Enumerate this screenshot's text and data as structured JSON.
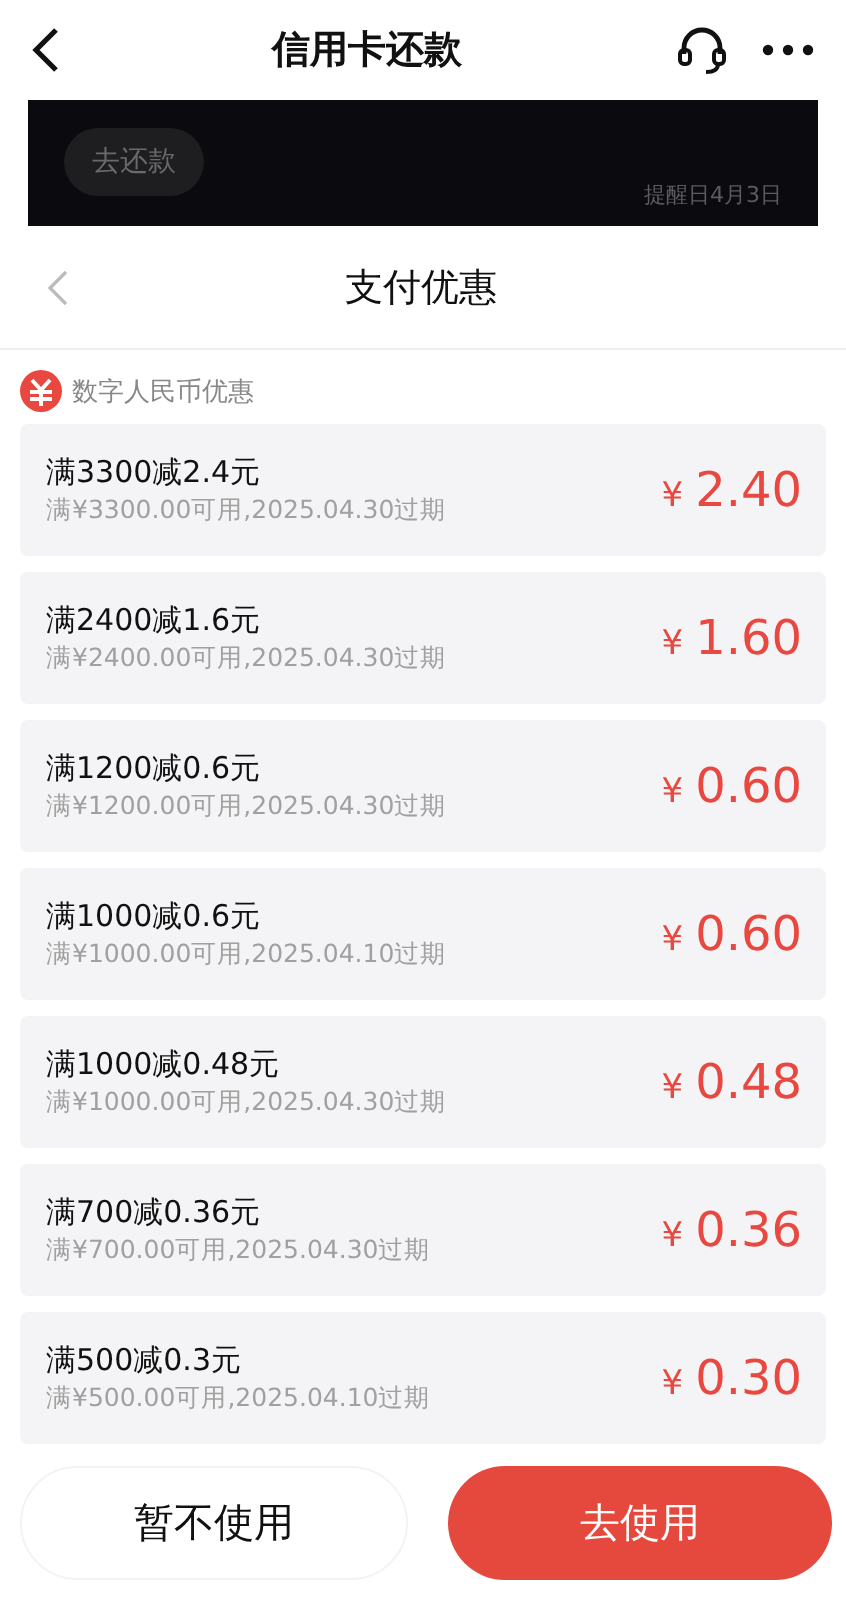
{
  "header": {
    "title": "信用卡还款"
  },
  "background": {
    "button": "去还款",
    "reminder": "提醒日4月3日"
  },
  "sheet": {
    "title": "支付优惠",
    "section": "数字人民币优惠",
    "coupons": [
      {
        "title": "满3300减2.4元",
        "detail": "满¥3300.00可用,2025.04.30过期",
        "currency": "¥",
        "amount": "2.40"
      },
      {
        "title": "满2400减1.6元",
        "detail": "满¥2400.00可用,2025.04.30过期",
        "currency": "¥",
        "amount": "1.60"
      },
      {
        "title": "满1200减0.6元",
        "detail": "满¥1200.00可用,2025.04.30过期",
        "currency": "¥",
        "amount": "0.60"
      },
      {
        "title": "满1000减0.6元",
        "detail": "满¥1000.00可用,2025.04.10过期",
        "currency": "¥",
        "amount": "0.60"
      },
      {
        "title": "满1000减0.48元",
        "detail": "满¥1000.00可用,2025.04.30过期",
        "currency": "¥",
        "amount": "0.48"
      },
      {
        "title": "满700减0.36元",
        "detail": "满¥700.00可用,2025.04.30过期",
        "currency": "¥",
        "amount": "0.36"
      },
      {
        "title": "满500减0.3元",
        "detail": "满¥500.00可用,2025.04.10过期",
        "currency": "¥",
        "amount": "0.30"
      }
    ],
    "buttons": [
      {
        "label": "暂不使用",
        "kind": "secondary"
      },
      {
        "label": "去使用",
        "kind": "primary"
      }
    ]
  }
}
